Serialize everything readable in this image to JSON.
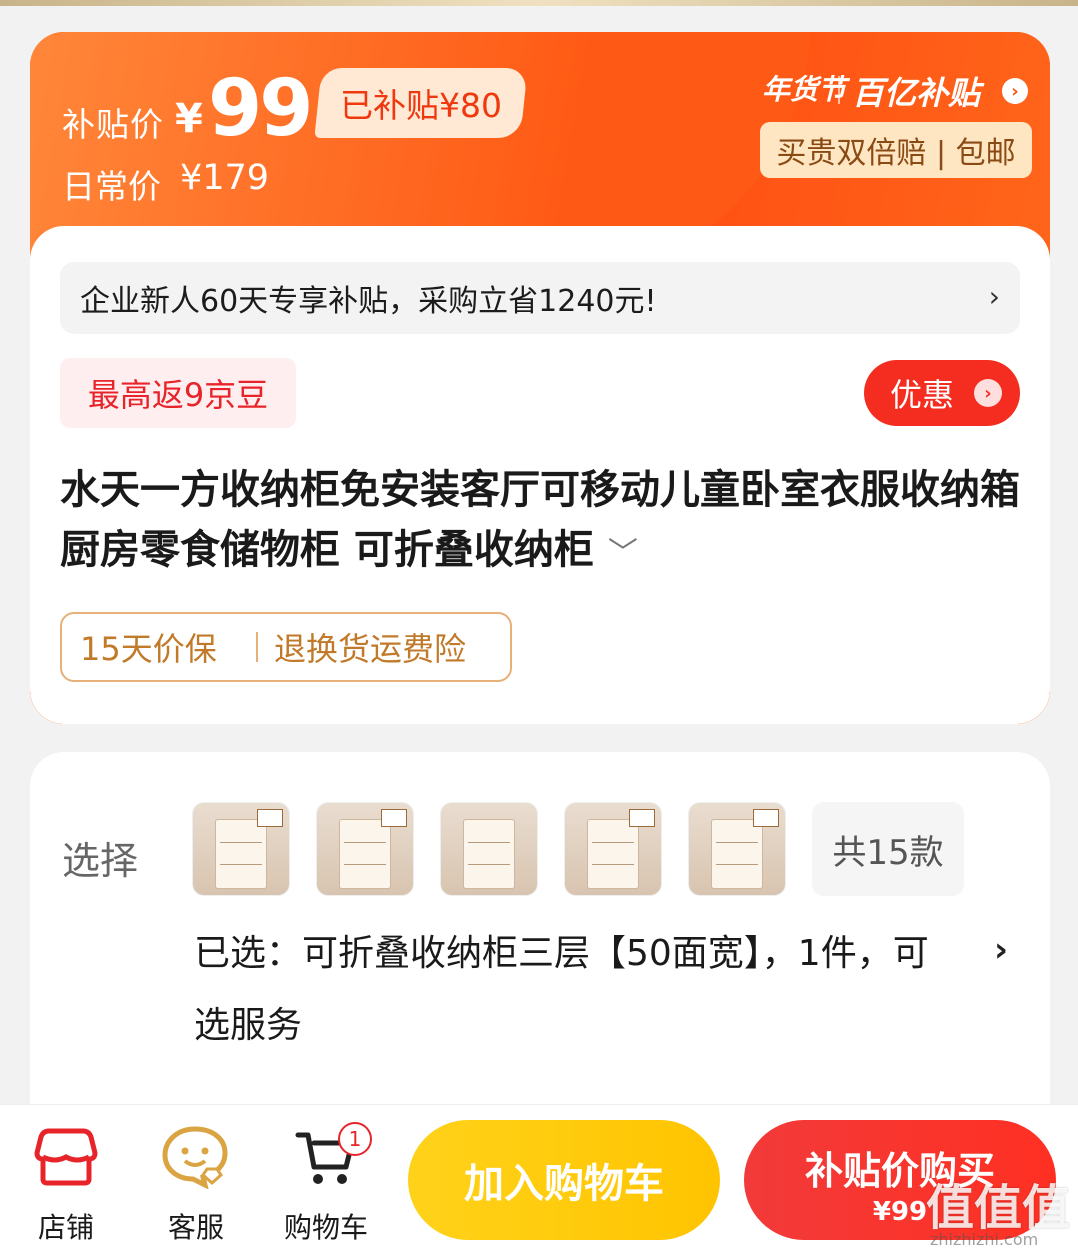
{
  "price_header": {
    "subsidy_label": "补贴价",
    "currency": "¥",
    "subsidy_price": "99",
    "subsidized_badge": "已补贴¥80",
    "daily_label": "日常价",
    "daily_price": "¥179",
    "festival": "年货节",
    "brand": "百亿补贴",
    "guarantee": "买贵双倍赔 | 包邮"
  },
  "promo_bar": {
    "text": "企业新人60天专享补贴，采购立省1240元!",
    "arrow": "›"
  },
  "jd_beans": "最高返9京豆",
  "youhui_button": "优惠",
  "product_title": "水天一方收纳柜免安装客厅可移动儿童卧室衣服收纳箱厨房零食储物柜 可折叠收纳柜",
  "service_tags": [
    "15天价保",
    "退换货运费险"
  ],
  "selection": {
    "label": "选择",
    "variant_count": "共15款",
    "selected_text": "已选：可折叠收纳柜三层【50面宽】，1件，可选服务",
    "arrow": "›"
  },
  "bottom_nav": {
    "store": "店铺",
    "service": "客服",
    "cart": "购物车",
    "cart_badge": "1",
    "add_to_cart": "加入购物车",
    "buy_line1": "补贴价购买",
    "buy_line2": "¥99"
  },
  "watermark": {
    "text": "值值值",
    "site": "zhizhizhi.com"
  },
  "colors": {
    "accent_orange": "#ff5214",
    "red": "#f52c20",
    "yellow": "#ffc400"
  }
}
